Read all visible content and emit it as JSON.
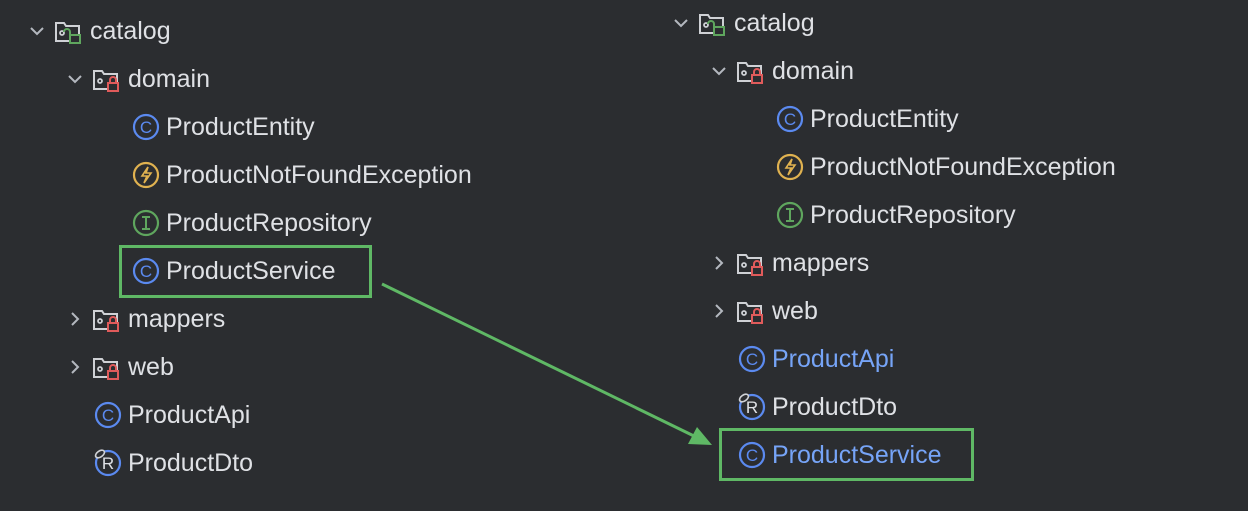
{
  "colors": {
    "background": "#2b2d30",
    "text": "#dfe1e5",
    "modified_text": "#76a4f7",
    "highlight": "#5fb865",
    "class_icon": "#5b8af0",
    "exception_icon": "#e0b250",
    "interface_icon": "#5fa65e",
    "lock_red": "#e05b5b",
    "lock_green": "#5fa65e"
  },
  "before": {
    "rows": [
      {
        "label": "catalog",
        "icon": "package-folder-open-lock-icon",
        "chevron": "expanded",
        "level": 0
      },
      {
        "label": "domain",
        "icon": "package-folder-lock-icon",
        "chevron": "expanded",
        "level": 1
      },
      {
        "label": "ProductEntity",
        "icon": "class-icon",
        "level": 2
      },
      {
        "label": "ProductNotFoundException",
        "icon": "exception-icon",
        "level": 2
      },
      {
        "label": "ProductRepository",
        "icon": "interface-icon",
        "level": 2
      },
      {
        "label": "ProductService",
        "icon": "class-icon",
        "level": 2,
        "highlighted": true
      },
      {
        "label": "mappers",
        "icon": "package-folder-lock-icon",
        "chevron": "collapsed",
        "level": 1
      },
      {
        "label": "web",
        "icon": "package-folder-lock-icon",
        "chevron": "collapsed",
        "level": 1
      },
      {
        "label": "ProductApi",
        "icon": "class-icon",
        "level": 1
      },
      {
        "label": "ProductDto",
        "icon": "record-icon",
        "level": 1
      }
    ]
  },
  "after": {
    "rows": [
      {
        "label": "catalog",
        "icon": "package-folder-open-lock-icon",
        "chevron": "expanded",
        "level": 0
      },
      {
        "label": "domain",
        "icon": "package-folder-lock-icon",
        "chevron": "expanded",
        "level": 1
      },
      {
        "label": "ProductEntity",
        "icon": "class-icon",
        "level": 2
      },
      {
        "label": "ProductNotFoundException",
        "icon": "exception-icon",
        "level": 2
      },
      {
        "label": "ProductRepository",
        "icon": "interface-icon",
        "level": 2
      },
      {
        "label": "mappers",
        "icon": "package-folder-lock-icon",
        "chevron": "collapsed",
        "level": 1
      },
      {
        "label": "web",
        "icon": "package-folder-lock-icon",
        "chevron": "collapsed",
        "level": 1
      },
      {
        "label": "ProductApi",
        "icon": "class-icon",
        "level": 1,
        "modified": true
      },
      {
        "label": "ProductDto",
        "icon": "record-icon",
        "level": 1
      },
      {
        "label": "ProductService",
        "icon": "class-icon",
        "level": 1,
        "modified": true,
        "highlighted": true
      }
    ]
  }
}
